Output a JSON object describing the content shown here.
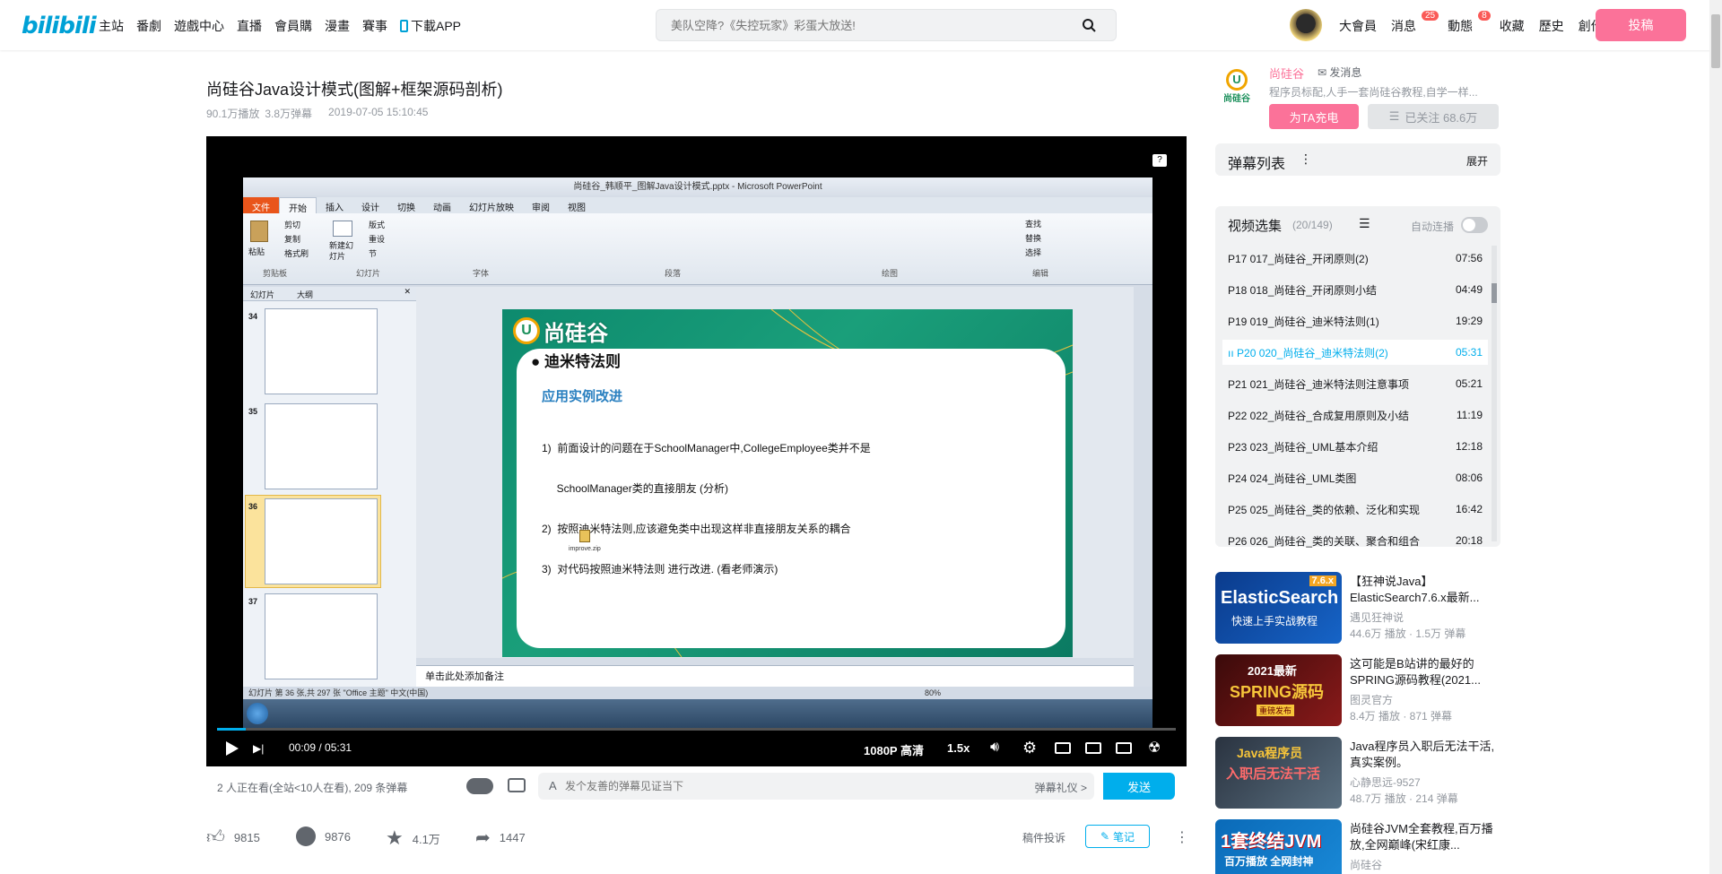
{
  "brand": {
    "logo": "bilibili",
    "accent": "#00aeec",
    "pink": "#fb7299"
  },
  "nav": {
    "items": [
      "主站",
      "番劇",
      "遊戲中心",
      "直播",
      "會員購",
      "漫畫",
      "賽事",
      "下載APP"
    ]
  },
  "search": {
    "placeholder": "美队空降?《失控玩家》彩蛋大放送!"
  },
  "user_nav": {
    "items": [
      "大會員",
      "消息",
      "動態",
      "收藏",
      "歷史",
      "創作中心"
    ],
    "badges": {
      "messages": "25",
      "dynamics": "8"
    },
    "upload": "投稿"
  },
  "video": {
    "title": "尚硅谷Java设计模式(图解+框架源码剖析)",
    "views": "90.1万播放",
    "danmaku": "3.8万弹幕",
    "date": "2019-07-05 15:10:45"
  },
  "player": {
    "time_current": "00:09",
    "time_total": "05:31",
    "quality": "1080P 高清",
    "speed": "1.5x",
    "progress_fraction": 0.03
  },
  "ppt": {
    "window_title": "尚硅谷_韩顺平_图解Java设计模式.pptx - Microsoft PowerPoint",
    "tabs": [
      "文件",
      "开始",
      "插入",
      "设计",
      "切换",
      "动画",
      "幻灯片放映",
      "审阅",
      "视图"
    ],
    "groups": [
      "剪贴板",
      "幻灯片",
      "字体",
      "段落",
      "绘图",
      "编辑"
    ],
    "clip": [
      "剪切",
      "复制",
      "格式刷",
      "粘贴"
    ],
    "slides_group": [
      "版式",
      "重设",
      "节",
      "新建幻灯片"
    ],
    "edit": [
      "查找",
      "替换",
      "选择"
    ],
    "panel_tabs": [
      "幻灯片",
      "大纲"
    ],
    "thumb_numbers": [
      "34",
      "35",
      "36",
      "37"
    ],
    "slide_logo": "尚硅谷",
    "bullet": "迪米特法则",
    "heading": "应用实例改进",
    "lines": [
      "1)  前面设计的问题在于SchoolManager中,CollegeEmployee类并不是",
      "     SchoolManager类的直接朋友 (分析)",
      "2)  按照迪米特法则,应该避免类中出现这样非直接朋友关系的耦合",
      "3)  对代码按照迪米特法则 进行改进. (看老师演示)"
    ],
    "file_icon_label": "improve.zip",
    "notes": "单击此处添加备注",
    "status": "幻灯片 第 36 张,共 297 张    \"Office 主题\"    中文(中国)",
    "zoom": "80%"
  },
  "danmaku_bar": {
    "online": "2 人正在看(全站<10人在看), 209 条弹幕",
    "input_placeholder": "发个友善的弹幕见证当下",
    "etiquette": "弹幕礼仪 >",
    "send": "发送"
  },
  "actions": {
    "like": "9815",
    "coin": "9876",
    "fav": "4.1万",
    "share": "1447",
    "report": "稿件投诉",
    "note": "笔记"
  },
  "uploader": {
    "name": "尚硅谷",
    "message": "发消息",
    "desc": "程序员标配,人手一套尚硅谷教程,自学一样...",
    "charge": "为TA充电",
    "follow": "已关注 68.6万",
    "logo_text": "尚硅谷"
  },
  "danmaku_list": {
    "title": "弹幕列表",
    "expand": "展开"
  },
  "episodes": {
    "title": "视频选集",
    "count": "(20/149)",
    "autoplay": "自动连播",
    "items": [
      {
        "label": "P17  017_尚硅谷_开闭原则(2)",
        "dur": "07:56"
      },
      {
        "label": "P18  018_尚硅谷_开闭原则小结",
        "dur": "04:49"
      },
      {
        "label": "P19  019_尚硅谷_迪米特法则(1)",
        "dur": "19:29"
      },
      {
        "label": "P20  020_尚硅谷_迪米特法则(2)",
        "dur": "05:31"
      },
      {
        "label": "P21  021_尚硅谷_迪米特法则注意事项",
        "dur": "05:21"
      },
      {
        "label": "P22  022_尚硅谷_合成复用原则及小结",
        "dur": "11:19"
      },
      {
        "label": "P23  023_尚硅谷_UML基本介绍",
        "dur": "12:18"
      },
      {
        "label": "P24  024_尚硅谷_UML类图",
        "dur": "08:06"
      },
      {
        "label": "P25  025_尚硅谷_类的依赖、泛化和实现",
        "dur": "16:42"
      },
      {
        "label": "P26  026_尚硅谷_类的关联、聚合和组合",
        "dur": "20:18"
      }
    ]
  },
  "recommend": [
    {
      "title": "【狂神说Java】ElasticSearch7.6.x最新...",
      "up": "遇见狂神说",
      "stats": "44.6万 播放 · 1.5万 弹幕",
      "thumb_big": "ElasticSearch",
      "thumb_small": "快速上手实战教程",
      "thumb_tag": "7.6.x"
    },
    {
      "title": "这可能是B站讲的最好的SPRING源码教程(2021...",
      "up": "图灵官方",
      "stats": "8.4万 播放 · 871 弹幕",
      "thumb_big": "SPRING源码",
      "thumb_small": "2021最新",
      "thumb_tag": "重磅发布"
    },
    {
      "title": "Java程序员入职后无法干活,真实案例。",
      "up": "心静思远-9527",
      "stats": "48.7万 播放 · 214 弹幕",
      "thumb_big": "入职后无法干活",
      "thumb_small": "Java程序员",
      "thumb_tag": ""
    },
    {
      "title": "尚硅谷JVM全套教程,百万播放,全网巅峰(宋红康...",
      "up": "尚硅谷",
      "stats": "",
      "thumb_big": "1套终结JVM",
      "thumb_small": "百万播放 全网封神",
      "thumb_tag": ""
    }
  ]
}
